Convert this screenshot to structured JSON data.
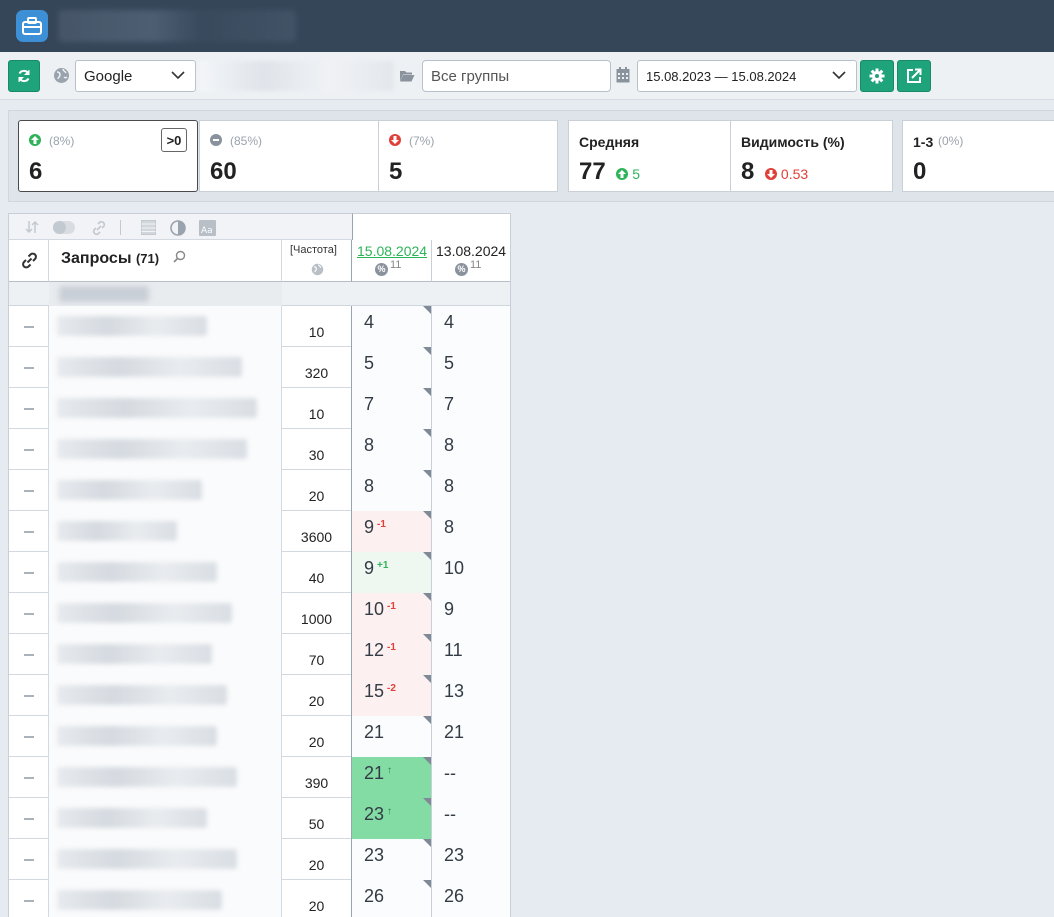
{
  "toolbar": {
    "search_engine": "Google",
    "groups_placeholder": "Все группы",
    "date_range": "15.08.2023 — 15.08.2024"
  },
  "stats": {
    "up": {
      "pct": "(8%)",
      "value": "6",
      "filter_label": ">0"
    },
    "same": {
      "pct": "(85%)",
      "value": "60"
    },
    "down": {
      "pct": "(7%)",
      "value": "5"
    },
    "average": {
      "label": "Средняя",
      "value": "77",
      "delta": "5"
    },
    "visibility": {
      "label": "Видимость (%)",
      "value": "8",
      "delta": "0.53"
    },
    "top3": {
      "label": "1-3",
      "pct": "(0%)",
      "value": "0"
    }
  },
  "colors": {
    "green": "#1fa37a",
    "red": "#e0403a",
    "up_green": "#2fb35a"
  },
  "table": {
    "queries_label": "Запросы",
    "queries_count": "(71)",
    "freq_label": "[Частота]",
    "date1": "15.08.2024",
    "date2": "13.08.2024",
    "date1_count": "11",
    "date2_count": "11",
    "rows": [
      {
        "freq": "10",
        "d1": "4",
        "chg": "",
        "d2": "4",
        "bg": "plain",
        "w": 150
      },
      {
        "freq": "320",
        "d1": "5",
        "chg": "",
        "d2": "5",
        "bg": "plain",
        "w": 185
      },
      {
        "freq": "10",
        "d1": "7",
        "chg": "",
        "d2": "7",
        "bg": "plain",
        "w": 200
      },
      {
        "freq": "30",
        "d1": "8",
        "chg": "",
        "d2": "8",
        "bg": "plain",
        "w": 190
      },
      {
        "freq": "20",
        "d1": "8",
        "chg": "",
        "d2": "8",
        "bg": "plain",
        "w": 145
      },
      {
        "freq": "3600",
        "d1": "9",
        "chg": "-1",
        "chgc": "red",
        "d2": "8",
        "bg": "red",
        "w": 120
      },
      {
        "freq": "40",
        "d1": "9",
        "chg": "+1",
        "chgc": "green",
        "d2": "10",
        "bg": "lgreen",
        "w": 160
      },
      {
        "freq": "1000",
        "d1": "10",
        "chg": "-1",
        "chgc": "red",
        "d2": "9",
        "bg": "red",
        "w": 175
      },
      {
        "freq": "70",
        "d1": "12",
        "chg": "-1",
        "chgc": "red",
        "d2": "11",
        "bg": "red",
        "w": 155
      },
      {
        "freq": "20",
        "d1": "15",
        "chg": "-2",
        "chgc": "red",
        "d2": "13",
        "bg": "red",
        "w": 170
      },
      {
        "freq": "20",
        "d1": "21",
        "chg": "",
        "d2": "21",
        "bg": "plain",
        "w": 160
      },
      {
        "freq": "390",
        "d1": "21",
        "chg": "↑",
        "chgc": "green",
        "d2": "--",
        "bg": "green",
        "w": 180
      },
      {
        "freq": "50",
        "d1": "23",
        "chg": "↑",
        "chgc": "green",
        "d2": "--",
        "bg": "green",
        "w": 150
      },
      {
        "freq": "20",
        "d1": "23",
        "chg": "",
        "d2": "23",
        "bg": "plain",
        "w": 180
      },
      {
        "freq": "20",
        "d1": "26",
        "chg": "",
        "d2": "26",
        "bg": "plain",
        "w": 165
      }
    ]
  }
}
